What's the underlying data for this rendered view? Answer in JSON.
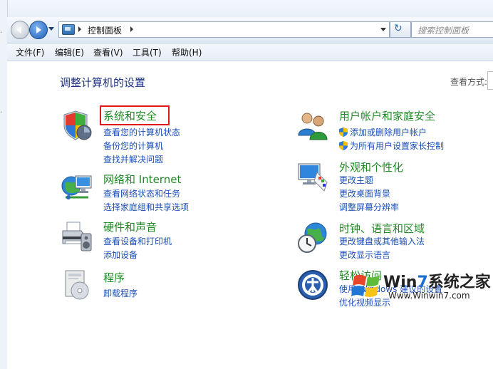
{
  "window": {
    "address_path": "控制面板",
    "search_placeholder": "搜索控制面板"
  },
  "menubar": {
    "items": [
      "文件(F)",
      "编辑(E)",
      "查看(V)",
      "工具(T)",
      "帮助(H)"
    ]
  },
  "content": {
    "heading": "调整计算机的设置",
    "view_by_label": "查看方式:",
    "categories": [
      {
        "title": "系统和安全",
        "icon": "shield-icon",
        "highlighted": true,
        "links": [
          "查看您的计算机状态",
          "备份您的计算机",
          "查找并解决问题"
        ]
      },
      {
        "title": "网络和 Internet",
        "icon": "network-globe-icon",
        "links": [
          "查看网络状态和任务",
          "选择家庭组和共享选项"
        ]
      },
      {
        "title": "硬件和声音",
        "icon": "printer-speaker-icon",
        "links": [
          "查看设备和打印机",
          "添加设备"
        ]
      },
      {
        "title": "程序",
        "icon": "programs-disc-icon",
        "links": [
          "卸载程序"
        ]
      },
      {
        "title": "用户帐户和家庭安全",
        "icon": "users-icon",
        "links": [
          "添加或删除用户帐户",
          "为所有用户设置家长控制"
        ]
      },
      {
        "title": "外观和个性化",
        "icon": "monitor-palette-icon",
        "links": [
          "更改主题",
          "更改桌面背景",
          "调整屏幕分辨率"
        ]
      },
      {
        "title": "时钟、语言和区域",
        "icon": "clock-globe-icon",
        "links": [
          "更改键盘或其他输入法",
          "更改显示语言"
        ]
      },
      {
        "title": "轻松访问",
        "icon": "ease-of-access-icon",
        "links": [
          "使用 Windows 建议的设置",
          "优化视频显示"
        ]
      }
    ]
  },
  "watermark": {
    "brand_prefix": "Win",
    "brand_seven": "7",
    "brand_suffix": "系统之家",
    "url": "Www.Winwin7.com"
  },
  "colors": {
    "category_title": "#1f8a24",
    "link": "#1a4fb8",
    "heading": "#1e3287",
    "highlight_border": "#e01818"
  }
}
